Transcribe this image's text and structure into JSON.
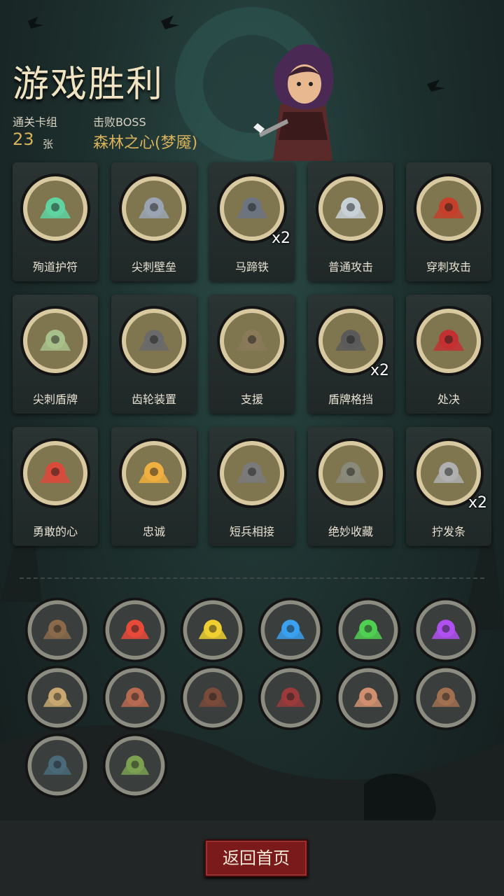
{
  "header": {
    "title": "游戏胜利",
    "deck_label": "通关卡组",
    "deck_count": "23",
    "deck_unit": "张",
    "boss_label": "击败BOSS",
    "boss_name": "森林之心(梦魇)"
  },
  "cards": [
    {
      "label": "殉道护符",
      "count": "",
      "icon": "skull-amulet-icon",
      "color": "#5fd3a0"
    },
    {
      "label": "尖刺壁垒",
      "count": "",
      "icon": "spike-wall-icon",
      "color": "#9aa4b2"
    },
    {
      "label": "马蹄铁",
      "count": "x2",
      "icon": "horseshoe-icon",
      "color": "#6b7480"
    },
    {
      "label": "普通攻击",
      "count": "",
      "icon": "sword-icon",
      "color": "#c9d1d8"
    },
    {
      "label": "穿刺攻击",
      "count": "",
      "icon": "spikes-icon",
      "color": "#c4402a"
    },
    {
      "label": "尖刺盾牌",
      "count": "",
      "icon": "spiked-shield-icon",
      "color": "#a8c08a"
    },
    {
      "label": "齿轮装置",
      "count": "",
      "icon": "gear-device-icon",
      "color": "#6a6a6a"
    },
    {
      "label": "支援",
      "count": "",
      "icon": "support-icon",
      "color": "#8a7a5a"
    },
    {
      "label": "盾牌格挡",
      "count": "x2",
      "icon": "shield-block-icon",
      "color": "#5a5a5a"
    },
    {
      "label": "处决",
      "count": "",
      "icon": "execute-icon",
      "color": "#c43030"
    },
    {
      "label": "勇敢的心",
      "count": "",
      "icon": "brave-heart-icon",
      "color": "#d84a3a"
    },
    {
      "label": "忠诚",
      "count": "",
      "icon": "cross-icon",
      "color": "#f0b040"
    },
    {
      "label": "短兵相接",
      "count": "",
      "icon": "knight-icon",
      "color": "#7a7a7a"
    },
    {
      "label": "绝妙收藏",
      "count": "",
      "icon": "treasure-icon",
      "color": "#8a8a7a"
    },
    {
      "label": "拧发条",
      "count": "x2",
      "icon": "wind-up-key-icon",
      "color": "#b0b0b0"
    }
  ],
  "relics": [
    {
      "icon": "cannon-icon",
      "color": "#8a6a4a"
    },
    {
      "icon": "music-skull-red-icon",
      "color": "#e84a3a"
    },
    {
      "icon": "music-skull-yellow-icon",
      "color": "#f0d030"
    },
    {
      "icon": "music-skull-blue-icon",
      "color": "#3aa0f0"
    },
    {
      "icon": "music-skull-green-icon",
      "color": "#50d050"
    },
    {
      "icon": "music-skull-purple-icon",
      "color": "#b050f0"
    },
    {
      "icon": "boxing-ring-icon",
      "color": "#c8a870"
    },
    {
      "icon": "brute-icon",
      "color": "#b86a50"
    },
    {
      "icon": "holy-book-icon",
      "color": "#7a4a3a"
    },
    {
      "icon": "vampire-icon",
      "color": "#9a3a3a"
    },
    {
      "icon": "card-hand-icon",
      "color": "#d09070"
    },
    {
      "icon": "toy-box-icon",
      "color": "#a07050"
    },
    {
      "icon": "dagger-icon",
      "color": "#4a6a7a"
    },
    {
      "icon": "ghost-troll-icon",
      "color": "#7aa050"
    }
  ],
  "footer": {
    "return_button": "返回首页"
  }
}
